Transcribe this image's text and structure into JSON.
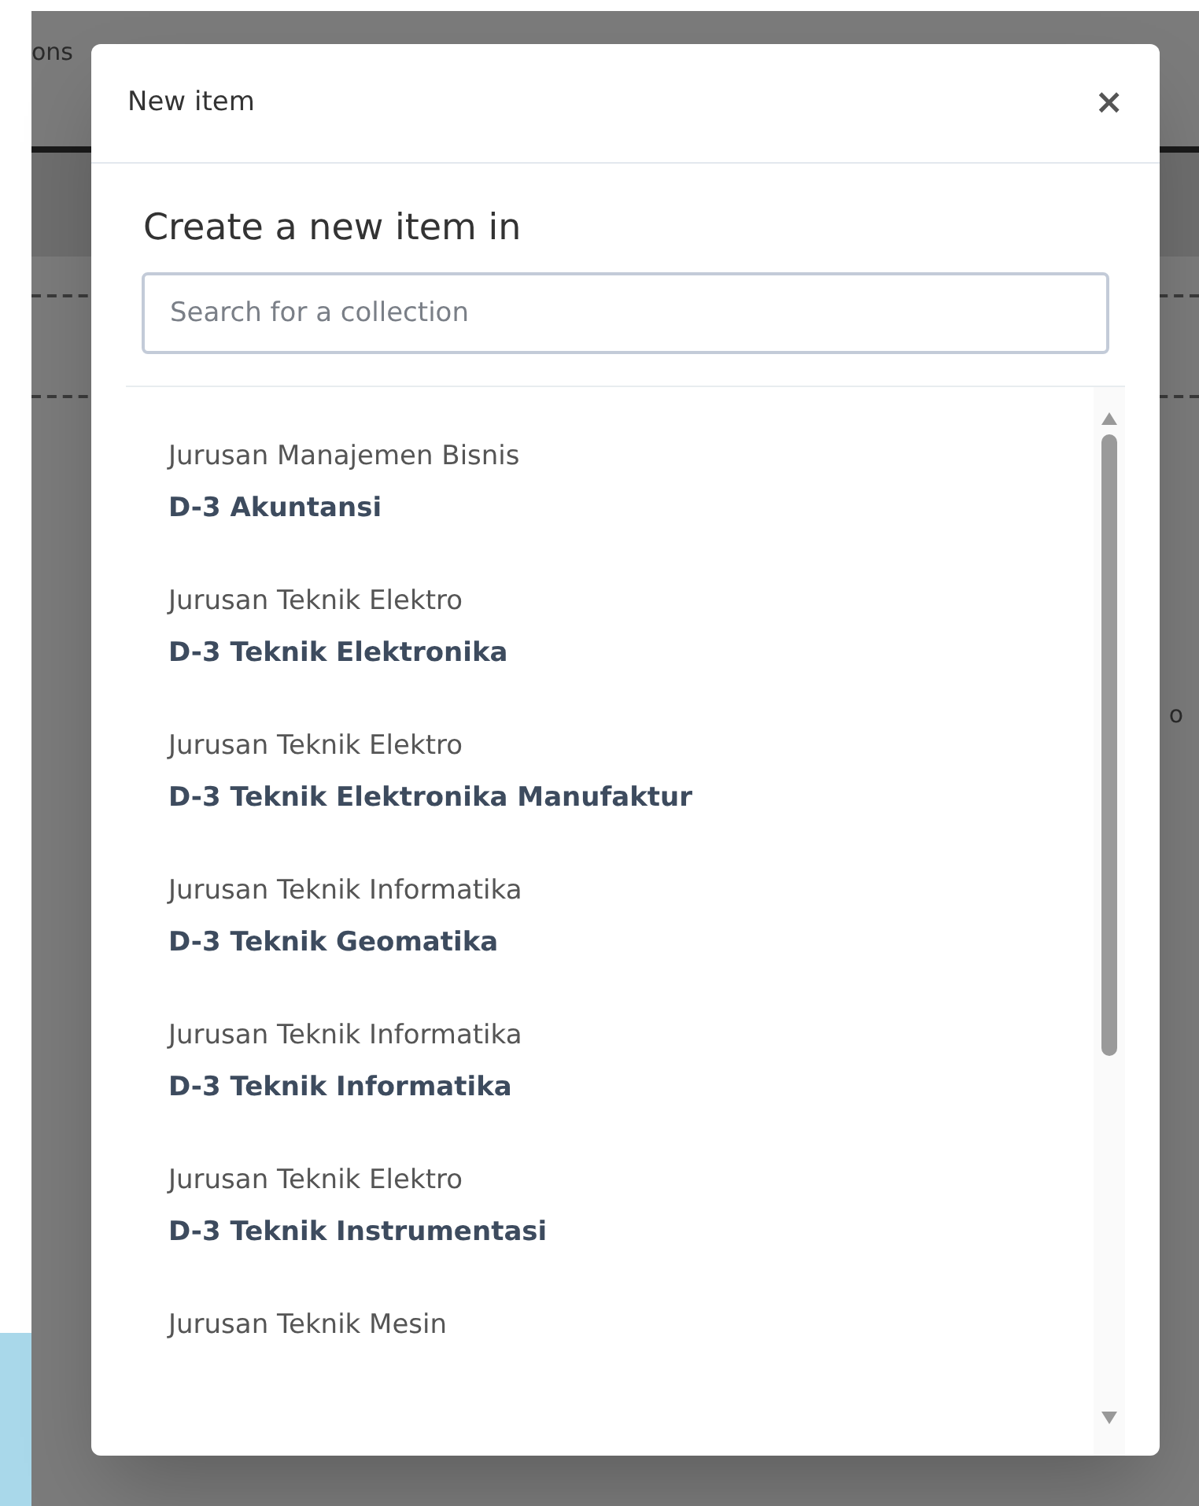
{
  "background": {
    "left_text": "ons",
    "right_text": "o"
  },
  "modal": {
    "title": "New item",
    "close": "×",
    "heading": "Create a new item in",
    "search": {
      "placeholder": "Search for a collection"
    },
    "items": [
      {
        "group": "Jurusan Manajemen Bisnis",
        "name": "D-3 Akuntansi"
      },
      {
        "group": "Jurusan Teknik Elektro",
        "name": "D-3 Teknik Elektronika"
      },
      {
        "group": "Jurusan Teknik Elektro",
        "name": "D-3 Teknik Elektronika Manufaktur"
      },
      {
        "group": "Jurusan Teknik Informatika",
        "name": "D-3 Teknik Geomatika"
      },
      {
        "group": "Jurusan Teknik Informatika",
        "name": "D-3 Teknik Informatika"
      },
      {
        "group": "Jurusan Teknik Elektro",
        "name": "D-3 Teknik Instrumentasi"
      },
      {
        "group": "Jurusan Teknik Mesin"
      }
    ]
  }
}
